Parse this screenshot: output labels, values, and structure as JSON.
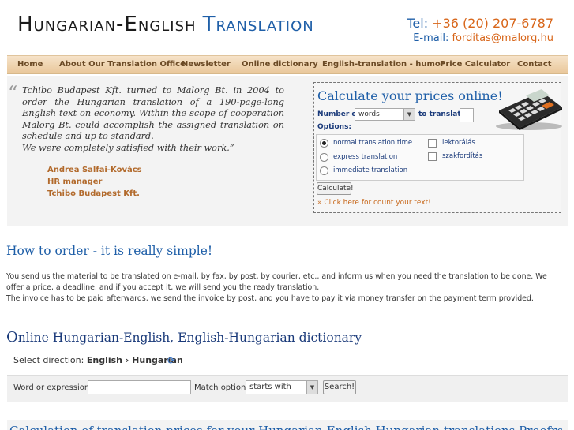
{
  "header": {
    "logo_part1": "Hungarian-English",
    "logo_part2": "Translation",
    "tel_label": "Tel:",
    "tel_value": "+36 (20) 207-6787",
    "email_label": "E-mail:",
    "email_value": "forditas@malorg.hu"
  },
  "nav": {
    "items": [
      "Home",
      "About Our Translation Office",
      "Newsletter",
      "Online dictionary",
      "English-translation - humor",
      "Price Calculator",
      "Contact"
    ]
  },
  "testimonial": {
    "quote_mark": "“",
    "text": "Tchibo Budapest Kft. turned to Malorg Bt. in 2004 to order the Hungarian translation of a 190-page-long English text on economy. Within the scope of cooperation Malorg Bt. could accomplish the assigned translation on schedule and up to standard.",
    "text2": "We were completely satisfied with their work.”",
    "name": "Andrea Salfai-Kovács",
    "role": "HR manager",
    "company": "Tchibo Budapest Kft."
  },
  "calculator": {
    "title": "Calculate your prices online!",
    "number_label": "Number of",
    "unit_selected": "words",
    "to_translate_label": "to translate:",
    "options_label": "Options:",
    "opt_normal": "normal translation time",
    "opt_express": "express translation",
    "opt_immediate": "immediate translation",
    "chk_lektoralas": "lektorálás",
    "chk_szakforditas": "szakfordítás",
    "button": "Calculate!",
    "count_link": "» Click here for count your text!"
  },
  "order": {
    "heading": "How to order - it is really simple!",
    "line1": "You send us the material to be translated on e-mail, by fax, by post, by courier, etc., and inform us when you need the translation to be done. We offer a price, a deadline, and if you accept it, we will send you the ready translation.",
    "line2": "The invoice has to be paid afterwards, we send the invoice by post, and you have to pay it via money transfer on the payment term provided."
  },
  "dictionary": {
    "heading_first": "O",
    "heading_rest": "nline Hungarian-English, English-Hungarian dictionary",
    "direction_label": "Select direction:",
    "direction_value": "English › Hungarian",
    "word_label": "Word or expression:",
    "word_value": "",
    "match_label": "Match option:",
    "match_selected": "starts with",
    "search_button": "Search!"
  },
  "bottom": {
    "text": "Calculation of translation prices for your Hungarian-English Hungarian translations    Proofreading Hungarian-English"
  },
  "colors": {
    "brand_blue": "#1f5fa8",
    "accent_orange": "#d8661a",
    "nav_bg": "#e9c79a",
    "signature": "#b26a2c"
  }
}
